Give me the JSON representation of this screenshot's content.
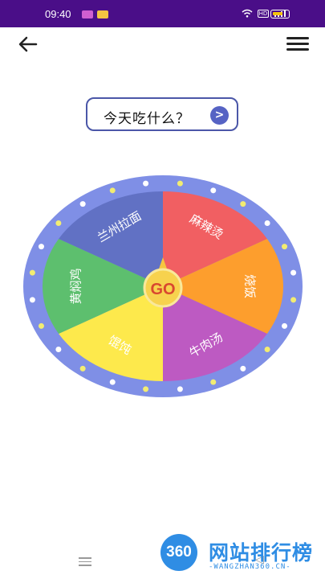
{
  "status_bar": {
    "time": "09:40",
    "net_badge": "HD"
  },
  "header": {
    "back_icon": "arrow-left-icon",
    "menu_icon": "hamburger-menu-icon"
  },
  "question": {
    "text": "今天吃什么？",
    "go_icon": "chevron-right-icon"
  },
  "wheel": {
    "center_label": "GO",
    "segments": [
      {
        "label": "麻辣烫",
        "color": "#f15f62"
      },
      {
        "label": "烧饭",
        "color": "#fd9e2d"
      },
      {
        "label": "牛肉汤",
        "color": "#bd5ac2"
      },
      {
        "label": "馄饨",
        "color": "#fde94c"
      },
      {
        "label": "黄焖鸡",
        "color": "#5dbf6e"
      },
      {
        "label": "兰州拉面",
        "color": "#6171c4"
      }
    ],
    "rim_color": "#7f8fe6",
    "dot_color": "#f2ec72"
  },
  "watermark": {
    "logo_text": "360",
    "title": "网站排行榜",
    "url": "-WANGZHAN360.CN-"
  }
}
